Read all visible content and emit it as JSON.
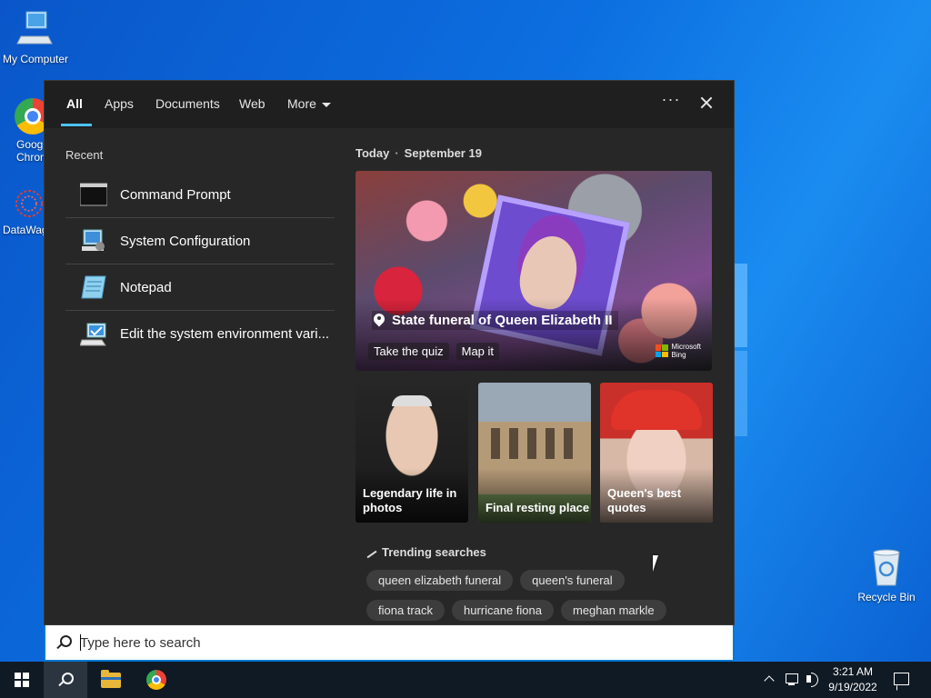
{
  "desktop": {
    "icons": [
      {
        "label": "My Computer"
      },
      {
        "label": "Goog Chron"
      },
      {
        "label": "DataWag"
      },
      {
        "label": "Recycle Bin"
      }
    ]
  },
  "search_panel": {
    "tabs": [
      {
        "label": "All",
        "active": true
      },
      {
        "label": "Apps"
      },
      {
        "label": "Documents"
      },
      {
        "label": "Web"
      },
      {
        "label": "More"
      }
    ],
    "ellipsis": "···",
    "recent": {
      "title": "Recent",
      "items": [
        {
          "name": "Command Prompt",
          "icon": "command-prompt-icon"
        },
        {
          "name": "System Configuration",
          "icon": "system-configuration-icon"
        },
        {
          "name": "Notepad",
          "icon": "notepad-icon"
        },
        {
          "name": "Edit the system environment vari...",
          "icon": "system-properties-icon"
        }
      ]
    },
    "today": {
      "label": "Today",
      "date": "September 19",
      "hero": {
        "headline": "State funeral of Queen Elizabeth II",
        "actions": [
          "Take the quiz",
          "Map it"
        ],
        "brand_line1": "Microsoft",
        "brand_line2": "Bing"
      },
      "cards": [
        {
          "caption_line1": "Legendary life in",
          "caption_line2": "photos"
        },
        {
          "caption_line1": "Final resting place",
          "caption_line2": ""
        },
        {
          "caption_line1": "Queen's best",
          "caption_line2": "quotes"
        }
      ]
    },
    "trending": {
      "title": "Trending searches",
      "rows": [
        [
          "queen elizabeth funeral",
          "queen's funeral"
        ],
        [
          "fiona track",
          "hurricane fiona",
          "meghan markle"
        ]
      ]
    }
  },
  "search_box": {
    "placeholder": "Type here to search",
    "value": ""
  },
  "taskbar": {
    "clock_time": "3:21 AM",
    "clock_date": "9/19/2022"
  },
  "colors": {
    "accent": "#4cc2ff",
    "panel_bg": "#272727",
    "taskbar_bg": "#101a24"
  }
}
